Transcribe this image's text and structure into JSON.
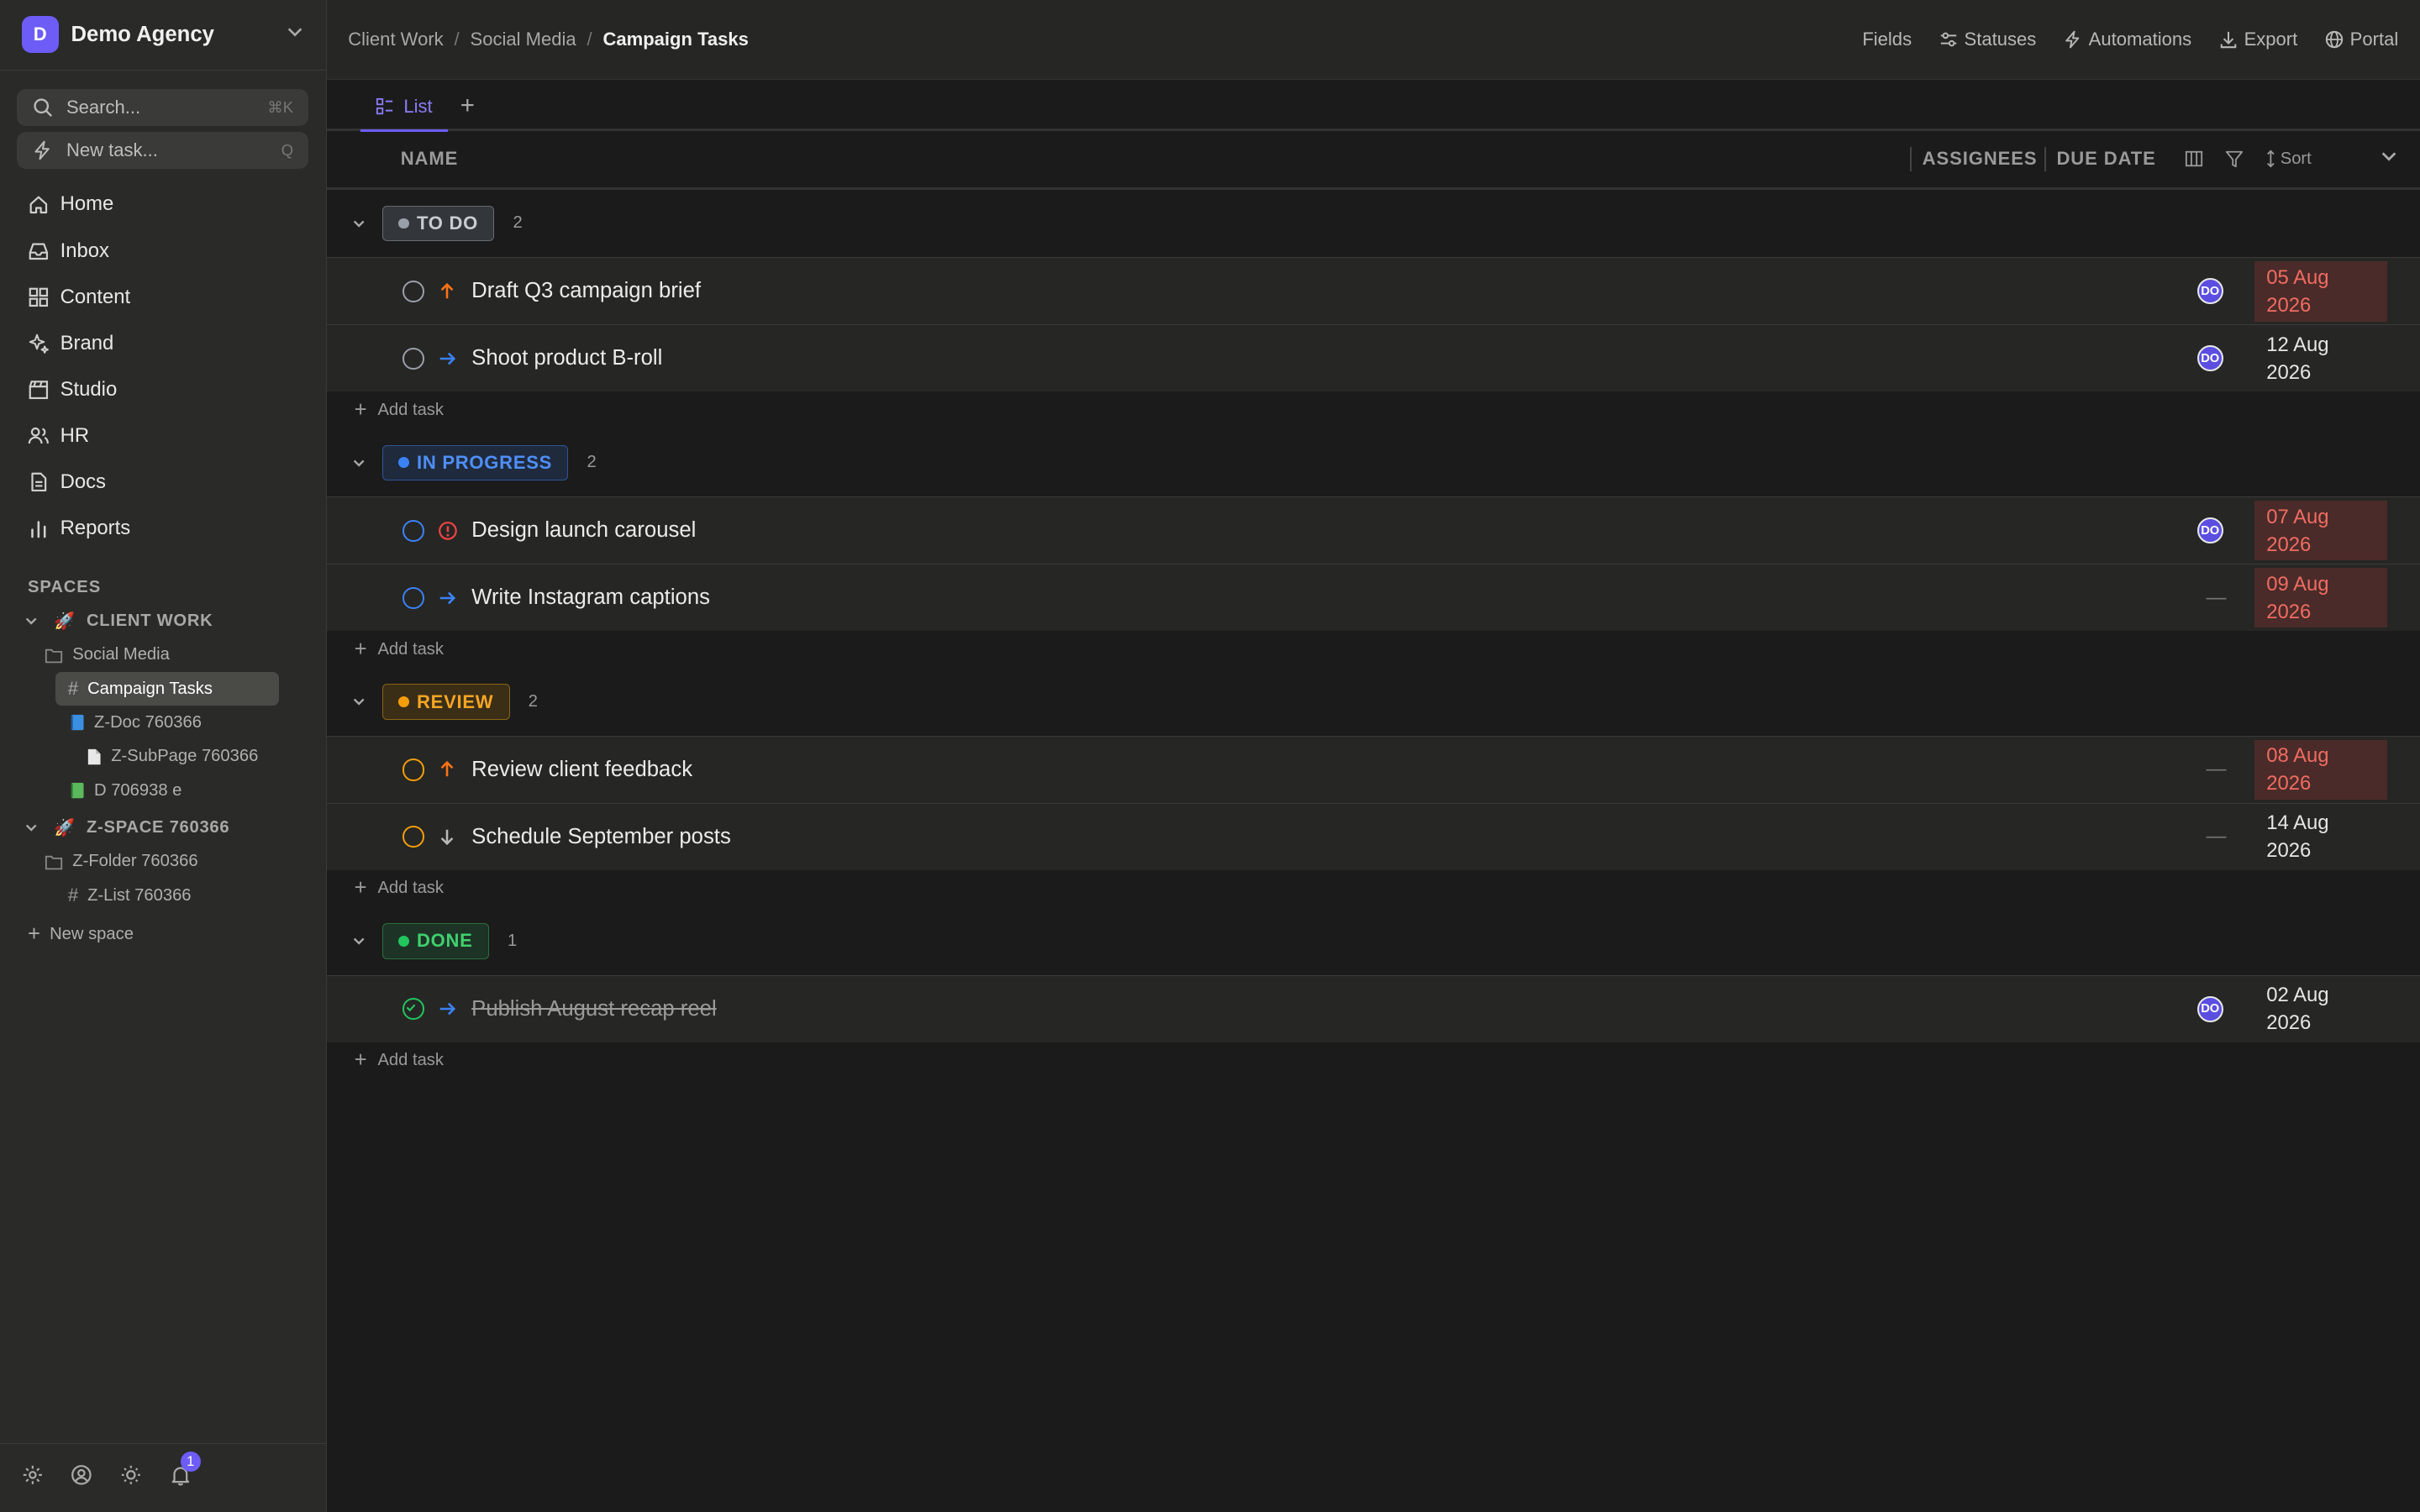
{
  "workspace": {
    "initial": "D",
    "name": "Demo Agency"
  },
  "search": {
    "placeholder": "Search...",
    "shortcut": "⌘K"
  },
  "newtask": {
    "label": "New task...",
    "shortcut": "Q"
  },
  "nav": [
    {
      "label": "Home",
      "icon": "home-icon"
    },
    {
      "label": "Inbox",
      "icon": "inbox-icon"
    },
    {
      "label": "Content",
      "icon": "grid-icon"
    },
    {
      "label": "Brand",
      "icon": "sparkle-icon"
    },
    {
      "label": "Studio",
      "icon": "clapper-icon"
    },
    {
      "label": "HR",
      "icon": "users-icon"
    },
    {
      "label": "Docs",
      "icon": "doc-icon"
    },
    {
      "label": "Reports",
      "icon": "bar-chart-icon"
    }
  ],
  "spaces": {
    "heading": "SPACES",
    "client_work": {
      "emoji": "🚀",
      "name": "CLIENT WORK",
      "folder": "Social Media",
      "list": "Campaign Tasks",
      "doc": "Z-Doc 760366",
      "subpage": "Z-SubPage 760366",
      "sheet": "D 706938 e"
    },
    "zspace": {
      "emoji": "🚀",
      "name": "Z-SPACE 760366",
      "folder": "Z-Folder 760366",
      "list": "Z-List 760366"
    },
    "new_space": "New space"
  },
  "notifications": {
    "count": "1"
  },
  "breadcrumb": {
    "c1": "Client Work",
    "c2": "Social Media",
    "current": "Campaign Tasks",
    "sep": "/"
  },
  "actions": {
    "fields": "Fields",
    "statuses": "Statuses",
    "automations": "Automations",
    "export": "Export",
    "portal": "Portal"
  },
  "tabs": {
    "list": "List",
    "add": "+"
  },
  "columns": {
    "name": "NAME",
    "assignees": "ASSIGNEES",
    "due": "DUE DATE",
    "sort": "Sort"
  },
  "add_task_label": "Add task",
  "groups": [
    {
      "label": "TO DO",
      "count": "2",
      "color": "#9aa0aa",
      "bg": "#33363b",
      "border": "#666a70",
      "text": "#c9ccd1",
      "tasks": [
        {
          "name": "Draft Q3 campaign brief",
          "priority": "high",
          "assignee": "DO",
          "due": "05 Aug 2026",
          "overdue": true
        },
        {
          "name": "Shoot product B-roll",
          "priority": "normal",
          "assignee": "DO",
          "due": "12 Aug 2026",
          "overdue": false
        }
      ]
    },
    {
      "label": "IN PROGRESS",
      "count": "2",
      "color": "#3b82f6",
      "bg": "#1f2a3d",
      "border": "#2e5596",
      "text": "#4f8ff7",
      "tasks": [
        {
          "name": "Design launch carousel",
          "priority": "urgent",
          "assignee": "DO",
          "due": "07 Aug 2026",
          "overdue": true
        },
        {
          "name": "Write Instagram captions",
          "priority": "normal",
          "assignee": "",
          "due": "09 Aug 2026",
          "overdue": true
        }
      ]
    },
    {
      "label": "REVIEW",
      "count": "2",
      "color": "#f59e0b",
      "bg": "#3a2e17",
      "border": "#8a6414",
      "text": "#f5a524",
      "tasks": [
        {
          "name": "Review client feedback",
          "priority": "high",
          "assignee": "",
          "due": "08 Aug 2026",
          "overdue": true
        },
        {
          "name": "Schedule September posts",
          "priority": "low",
          "assignee": "",
          "due": "14 Aug 2026",
          "overdue": false
        }
      ]
    },
    {
      "label": "DONE",
      "count": "1",
      "color": "#22c55e",
      "bg": "#1d3325",
      "border": "#2c7040",
      "text": "#3fd06f",
      "tasks": [
        {
          "name": "Publish August recap reel",
          "priority": "normal",
          "assignee": "DO",
          "due": "02 Aug 2026",
          "overdue": false,
          "done": true
        }
      ]
    }
  ]
}
